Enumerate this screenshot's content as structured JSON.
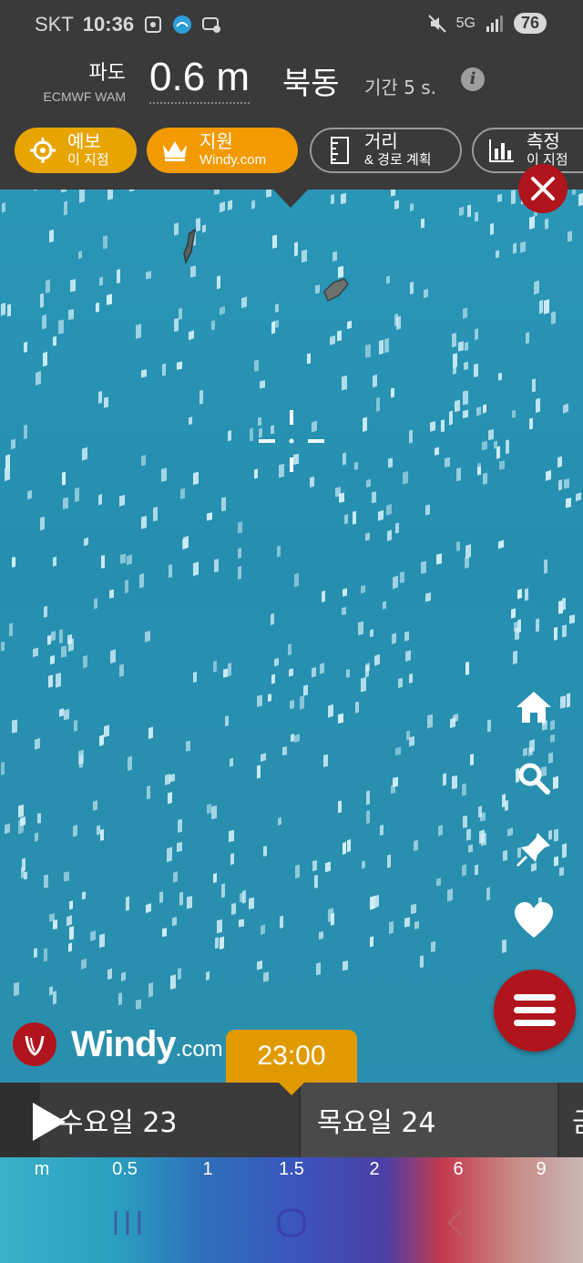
{
  "status_bar": {
    "carrier": "SKT",
    "time": "10:36",
    "network": "5G",
    "battery": "76"
  },
  "header": {
    "param_name": "파도",
    "model": "ECMWF WAM",
    "value": "0.6 m",
    "direction": "북동",
    "period": "기간 5 s.",
    "info_icon": "info-icon"
  },
  "pills": [
    {
      "title": "예보",
      "subtitle": "이 지점",
      "icon": "crosshair-icon"
    },
    {
      "title": "지원",
      "subtitle": "Windy.com",
      "icon": "crown-icon"
    },
    {
      "title": "거리",
      "subtitle": "& 경로 계획",
      "icon": "ruler-icon"
    },
    {
      "title": "측정",
      "subtitle": "이 지점",
      "icon": "bar-chart-icon"
    }
  ],
  "logo": {
    "brand": "Windy",
    "suffix": "com"
  },
  "timeline": {
    "current_time": "23:00",
    "days": [
      "수요일 23",
      "목요일 24",
      "금"
    ]
  },
  "legend": {
    "unit": "m",
    "ticks": [
      "0.5",
      "1",
      "1.5",
      "2",
      "6",
      "9"
    ]
  },
  "colors": {
    "accent": "#e8a400",
    "danger": "#b0141c",
    "panel": "#3a3a3a",
    "sea": "#2a8fb0"
  }
}
